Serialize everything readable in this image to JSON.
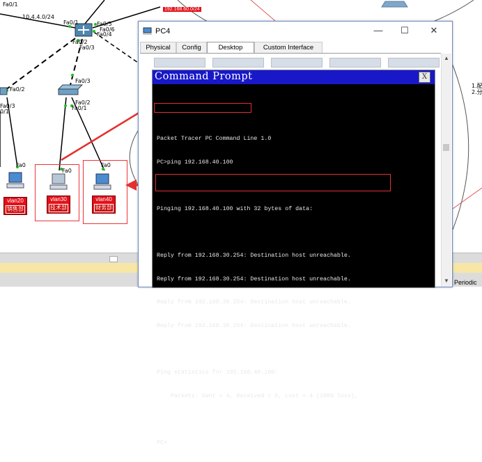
{
  "topology": {
    "labels": {
      "fa01_top": "Fa0/1",
      "subnet_left": "10.4.4.0/24",
      "subnet_badge": "192.168.60.0/24",
      "sw_fa01": "Fa0/1",
      "sw_fa05": "Fa0/5",
      "sw_fa06": "Fa0/6",
      "sw_fa04": "Fa0/4",
      "sw_fa02": "Fa0/2",
      "sw_fa03": "Fa0/3",
      "left_fa02": "Fa0/2",
      "left_fa03": "Fa0/3",
      "left_01": "0/1",
      "mid_fa03": "Fa0/3",
      "mid_fa02": "Fa0/2",
      "mid_fa01": "Fa0/1",
      "pc1_fa0": "Fa0",
      "pc2_fa0": "Fa0",
      "pc3_fa0": "Fa0",
      "right_note_1": "1.配",
      "right_note_2": "2.分"
    },
    "pcs": [
      {
        "vlan": "vlan20",
        "dept": "销售部"
      },
      {
        "vlan": "vlan30",
        "dept": "技术部"
      },
      {
        "vlan": "vlan40",
        "dept": "财务部"
      }
    ]
  },
  "bottom_bar": {
    "periodic_label": "Periodic"
  },
  "window": {
    "title": "PC4",
    "controls": {
      "minimize": "—",
      "maximize": "☐",
      "close": "✕"
    },
    "tabs": [
      "Physical",
      "Config",
      "Desktop",
      "Custom Interface"
    ],
    "active_tab": "Desktop"
  },
  "command_prompt": {
    "title": "Command Prompt",
    "close_label": "X",
    "lines": [
      "",
      "Packet Tracer PC Command Line 1.0",
      "PC>ping 192.168.40.100",
      "",
      "Pinging 192.168.40.100 with 32 bytes of data:",
      "",
      "Reply from 192.168.30.254: Destination host unreachable.",
      "Reply from 192.168.30.254: Destination host unreachable.",
      "Reply from 192.168.30.254: Destination host unreachable.",
      "Reply from 192.168.30.254: Destination host unreachable.",
      "",
      "Ping statistics for 192.168.40.100:",
      "    Packets: Sent = 4, Received = 0, Lost = 4 (100% loss),",
      "",
      "PC>"
    ]
  },
  "colors": {
    "accent_red": "#e53030",
    "cmd_header": "#1818c8",
    "vlan_badge": "#e2101a",
    "link_green": "#19c219"
  }
}
